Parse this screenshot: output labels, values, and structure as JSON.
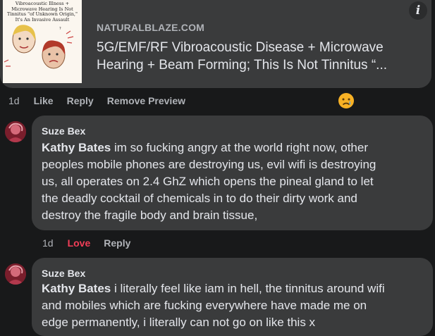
{
  "preview": {
    "thumbnail_caption": "Vibroacoustic Illness + Microwave Hearing Is Not Tinnitus \"of Unknown Origin,\" It's An Invasive Assault",
    "info_icon_glyph": "i",
    "domain": "NATURALBLAZE.COM",
    "title": "5G/EMF/RF Vibroacoustic Disease + Microwave Hearing + Beam Forming; This Is Not Tinnitus “..."
  },
  "post_actions": {
    "time": "1d",
    "like": "Like",
    "reply": "Reply",
    "remove_preview": "Remove Preview",
    "reaction_icon": "sad-face-emoji"
  },
  "comments": [
    {
      "author": "Suze Bex",
      "mention": "Kathy Bates",
      "lines": [
        " im so fucking angry at the world right now, other",
        "peoples mobile phones are destroying us, evil wifi is destroying",
        "us, all operates on 2.4 GhZ which opens the pineal gland to let",
        "the deadly cocktail of chemicals in to do their dirty work and",
        "destroy the fragile body and brain tissue,"
      ],
      "actions": {
        "time": "1d",
        "love": "Love",
        "reply": "Reply"
      }
    },
    {
      "author": "Suze Bex",
      "mention": "Kathy Bates",
      "lines": [
        " i literally feel like iam in hell, the tinnitus around wifi",
        "and mobiles which are fucking everywhere have made me on",
        "edge permanently, i literally can not go on like this x"
      ]
    }
  ],
  "colors": {
    "background": "#18191a",
    "bubble": "#3a3b3c",
    "secondary_text": "#b0b3b8",
    "love_red": "#f33e58"
  }
}
